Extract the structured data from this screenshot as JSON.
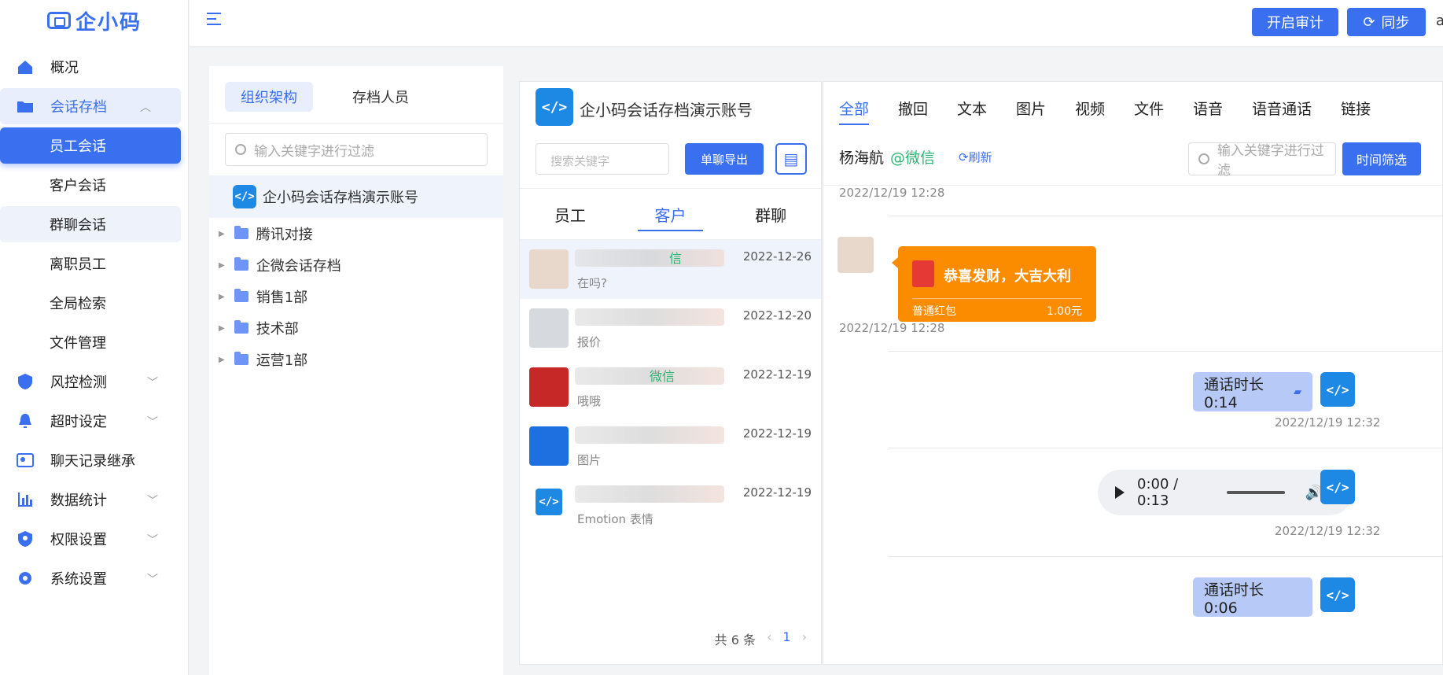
{
  "app": {
    "logo_text": "企小码"
  },
  "sidebar": {
    "items": [
      {
        "label": "概况",
        "icon": "home-icon"
      },
      {
        "label": "会话存档",
        "icon": "folder-icon",
        "expanded": true
      },
      {
        "label": "员工会话",
        "sub": true,
        "active": true
      },
      {
        "label": "客户会话",
        "sub": true
      },
      {
        "label": "群聊会话",
        "sub": true
      },
      {
        "label": "离职员工",
        "sub": true
      },
      {
        "label": "全局检索",
        "sub": true
      },
      {
        "label": "文件管理",
        "sub": true
      },
      {
        "label": "风控检测",
        "icon": "shield-icon"
      },
      {
        "label": "超时设定",
        "icon": "bell-icon"
      },
      {
        "label": "聊天记录继承",
        "icon": "inherit-icon"
      },
      {
        "label": "数据统计",
        "icon": "bar-chart-icon"
      },
      {
        "label": "权限设置",
        "icon": "lock-shield-icon"
      },
      {
        "label": "系统设置",
        "icon": "gear-icon"
      }
    ]
  },
  "topbar": {
    "audit_label": "开启审计",
    "sync_label": "同步",
    "user_initial": "a"
  },
  "org": {
    "tabs": [
      "组织架构",
      "存档人员"
    ],
    "filter_placeholder": "输入关键字进行过滤",
    "account": "企小码会话存档演示账号",
    "departments": [
      "腾讯对接",
      "企微会话存档",
      "销售1部",
      "技术部",
      "运营1部"
    ]
  },
  "mid": {
    "account_title": "企小码会话存档演示账号",
    "search_placeholder": "搜索关键字",
    "export_label": "单聊导出",
    "tabs": [
      "员工",
      "客户",
      "群聊"
    ],
    "contacts": [
      {
        "name_suffix": "信",
        "date": "2022-12-26",
        "msg": "在吗?"
      },
      {
        "name_suffix": "",
        "date": "2022-12-20",
        "msg": "报价"
      },
      {
        "name_suffix": "微信",
        "date": "2022-12-19",
        "msg": "哦哦"
      },
      {
        "name_suffix": "",
        "date": "2022-12-19",
        "msg": "图片"
      },
      {
        "name_suffix": "",
        "date": "2022-12-19",
        "msg": "Emotion 表情"
      }
    ],
    "pager": {
      "total": "共 6 条",
      "page": "1"
    }
  },
  "chat": {
    "tabs": [
      "全部",
      "撤回",
      "文本",
      "图片",
      "视频",
      "文件",
      "语音",
      "语音通话",
      "链接"
    ],
    "contact_name": "杨海航",
    "contact_source": "@微信",
    "refresh_label": "刷新",
    "filter_placeholder": "输入关键字进行过滤",
    "time_filter_label": "时间筛选",
    "ts1": "2022/12/19 12:28",
    "ts2": "2022/12/19 12:28",
    "ts3": "2022/12/19 12:32",
    "ts4": "2022/12/19 12:32",
    "redpacket": {
      "title": "恭喜发财，大吉大利",
      "type": "普通红包",
      "amount": "1.00元"
    },
    "call1": "通话时长  0:14",
    "audio_time": "0:00 / 0:13",
    "call2": "通话时长  0:06"
  }
}
